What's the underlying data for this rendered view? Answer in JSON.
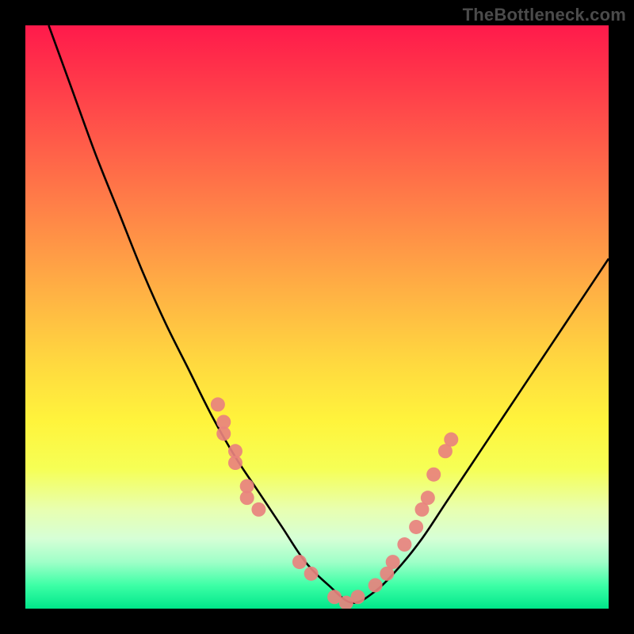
{
  "attribution": "TheBottleneck.com",
  "chart_data": {
    "type": "line",
    "title": "",
    "xlabel": "",
    "ylabel": "",
    "xlim": [
      0,
      100
    ],
    "ylim": [
      0,
      100
    ],
    "grid": false,
    "legend": false,
    "series": [
      {
        "name": "bottleneck-curve",
        "x": [
          4,
          8,
          12,
          16,
          20,
          24,
          28,
          32,
          36,
          40,
          44,
          48,
          52,
          56,
          60,
          64,
          68,
          72,
          76,
          80,
          84,
          88,
          92,
          96,
          100
        ],
        "y": [
          100,
          89,
          78,
          68,
          58,
          49,
          41,
          33,
          26,
          20,
          14,
          8,
          4,
          1,
          3,
          7,
          12,
          18,
          24,
          30,
          36,
          42,
          48,
          54,
          60
        ]
      }
    ],
    "markers": {
      "name": "benchmark-points",
      "color": "#e8827e",
      "points": [
        {
          "x": 33,
          "y": 35
        },
        {
          "x": 34,
          "y": 32
        },
        {
          "x": 34,
          "y": 30
        },
        {
          "x": 36,
          "y": 27
        },
        {
          "x": 36,
          "y": 25
        },
        {
          "x": 38,
          "y": 21
        },
        {
          "x": 38,
          "y": 19
        },
        {
          "x": 40,
          "y": 17
        },
        {
          "x": 47,
          "y": 8
        },
        {
          "x": 49,
          "y": 6
        },
        {
          "x": 53,
          "y": 2
        },
        {
          "x": 55,
          "y": 1
        },
        {
          "x": 57,
          "y": 2
        },
        {
          "x": 60,
          "y": 4
        },
        {
          "x": 62,
          "y": 6
        },
        {
          "x": 63,
          "y": 8
        },
        {
          "x": 65,
          "y": 11
        },
        {
          "x": 67,
          "y": 14
        },
        {
          "x": 68,
          "y": 17
        },
        {
          "x": 69,
          "y": 19
        },
        {
          "x": 70,
          "y": 23
        },
        {
          "x": 72,
          "y": 27
        },
        {
          "x": 73,
          "y": 29
        }
      ]
    },
    "background_gradient": [
      "#ff1a4b",
      "#ffd93f",
      "#f6ff55",
      "#00e68a"
    ]
  }
}
